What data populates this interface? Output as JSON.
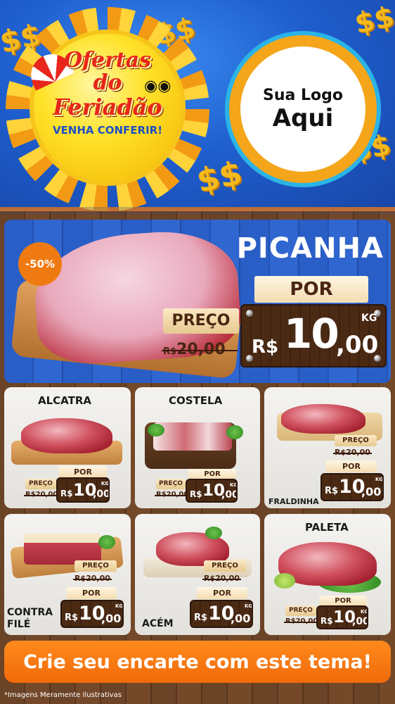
{
  "header": {
    "sun_title_line1": "Ofertas",
    "sun_title_line2": "do",
    "sun_title_line3": "Feriadão",
    "sun_subtitle": "VENHA CONFERIR!",
    "dollar_symbol": "$$",
    "logo_line1": "Sua Logo",
    "logo_line2": "Aqui"
  },
  "hero": {
    "name": "PICANHA",
    "discount_badge": "-50%",
    "por_label": "POR",
    "preco_label": "PREÇO",
    "old_currency": "R$",
    "old_price": "20,00",
    "currency": "R$",
    "price_int": "10",
    "price_dec": ",00",
    "unit": "KG"
  },
  "products": [
    {
      "name": "ALCATRA",
      "preco_label": "PREÇO",
      "old_price": "R$20,00",
      "por_label": "POR",
      "currency": "R$",
      "price_int": "10",
      "price_dec": ",00",
      "unit": "KG"
    },
    {
      "name": "COSTELA",
      "preco_label": "PREÇO",
      "old_price": "R$20,00",
      "por_label": "POR",
      "currency": "R$",
      "price_int": "10",
      "price_dec": ",00",
      "unit": "KG"
    },
    {
      "name": "FRALDINHA",
      "preco_label": "PREÇO",
      "old_price": "R$20,00",
      "por_label": "POR",
      "currency": "R$",
      "price_int": "10",
      "price_dec": ",00",
      "unit": "KG"
    },
    {
      "name_line1": "CONTRA",
      "name_line2": "FILÉ",
      "preco_label": "PREÇO",
      "old_price": "R$20,00",
      "por_label": "POR",
      "currency": "R$",
      "price_int": "10",
      "price_dec": ",00",
      "unit": "KG"
    },
    {
      "name": "ACÉM",
      "preco_label": "PREÇO",
      "old_price": "R$20,00",
      "por_label": "POR",
      "currency": "R$",
      "price_int": "10",
      "price_dec": ",00",
      "unit": "KG"
    },
    {
      "name": "PALETA",
      "preco_label": "PREÇO",
      "old_price": "R$20,00",
      "por_label": "POR",
      "currency": "R$",
      "price_int": "10",
      "price_dec": ",00",
      "unit": "KG"
    }
  ],
  "footer": {
    "cta": "Crie seu encarte com este tema!",
    "disclaimer": "*Imagens Meramente Ilustrativas"
  },
  "colors": {
    "header_blue": "#1f5fcf",
    "accent_orange": "#f07a12",
    "sun_yellow": "#ffd43a",
    "title_red": "#e8261c",
    "wood_brown": "#4b2a14"
  }
}
